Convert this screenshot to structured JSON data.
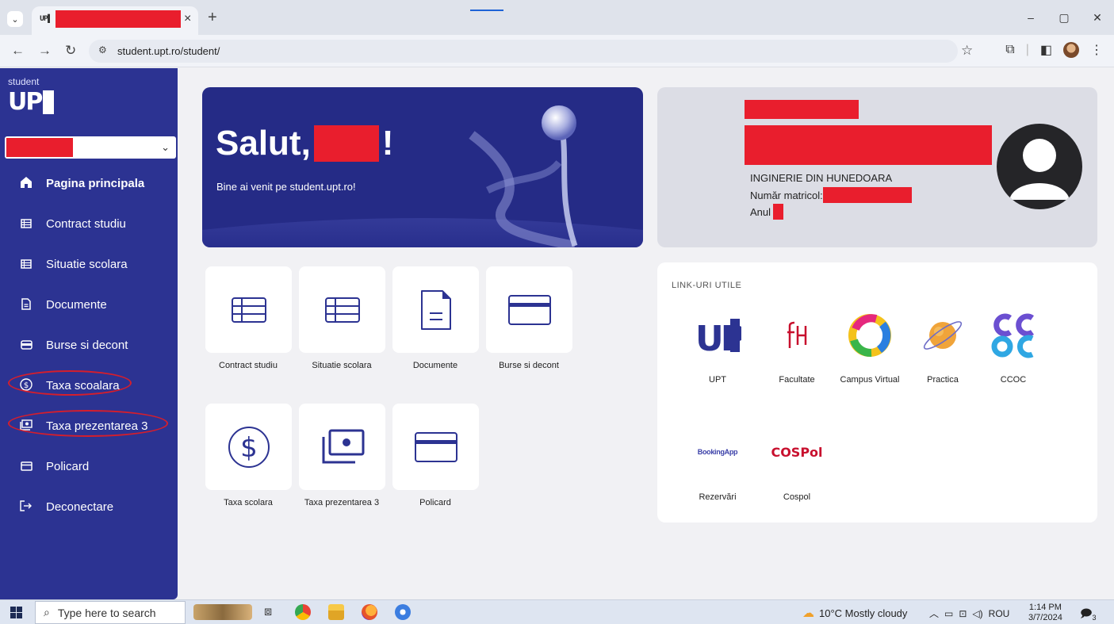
{
  "browser": {
    "tab_close": "×",
    "new_tab": "+",
    "url": "student.upt.ro/student/",
    "window_controls": [
      "–",
      "▢",
      "✕"
    ]
  },
  "sidebar": {
    "brand_small": "student",
    "brand_logo": "UP",
    "items": [
      {
        "label": "Pagina principala",
        "icon": "home-icon"
      },
      {
        "label": "Contract studiu",
        "icon": "list-icon"
      },
      {
        "label": "Situatie scolara",
        "icon": "list-icon"
      },
      {
        "label": "Documente",
        "icon": "document-icon"
      },
      {
        "label": "Burse si decont",
        "icon": "wallet-icon"
      },
      {
        "label": "Taxa scoalara",
        "icon": "dollar-circle-icon"
      },
      {
        "label": "Taxa prezentarea 3",
        "icon": "money-icon"
      },
      {
        "label": "Policard",
        "icon": "card-icon"
      },
      {
        "label": "Deconectare",
        "icon": "logout-icon"
      }
    ]
  },
  "hero": {
    "greeting_prefix": "Salut,",
    "greeting_suffix": "!",
    "subtitle": "Bine ai venit pe student.upt.ro!"
  },
  "profile": {
    "faculty": "INGINERIE DIN HUNEDOARA",
    "matricol_label": "Număr matricol:",
    "year_label": "Anul"
  },
  "tiles": [
    {
      "label": "Contract studiu",
      "icon": "table-icon"
    },
    {
      "label": "Situatie scolara",
      "icon": "table-icon"
    },
    {
      "label": "Documente",
      "icon": "document-icon"
    },
    {
      "label": "Burse si decont",
      "icon": "card-icon"
    },
    {
      "label": "Taxa scolara",
      "icon": "dollar-circle-icon"
    },
    {
      "label": "Taxa prezentarea 3",
      "icon": "money-icon"
    },
    {
      "label": "Policard",
      "icon": "card-icon"
    }
  ],
  "links": {
    "title": "LINK-URI UTILE",
    "items": [
      {
        "label": "UPT",
        "icon": "upt-logo"
      },
      {
        "label": "Facultate",
        "icon": "faculty-logo"
      },
      {
        "label": "Campus Virtual",
        "icon": "campus-virtual-logo"
      },
      {
        "label": "Practica",
        "icon": "practica-logo"
      },
      {
        "label": "CCOC",
        "icon": "ccoc-logo"
      },
      {
        "label": "Rezervări",
        "icon": "booking-app-logo",
        "logo_text": "BookingApp"
      },
      {
        "label": "Cospol",
        "icon": "cospol-logo",
        "logo_text": "COSPol"
      }
    ]
  },
  "taskbar": {
    "search_placeholder": "Type here to search",
    "weather": "10°C  Mostly cloudy",
    "language": "ROU",
    "time": "1:14 PM",
    "date": "3/7/2024",
    "notification_count": "3"
  },
  "colors": {
    "sidebar_bg": "#2c3392",
    "hero_bg": "#252b86",
    "redaction": "#e91e2d",
    "annotation_circle": "#d51e2c",
    "tile_icon": "#2c3392"
  }
}
